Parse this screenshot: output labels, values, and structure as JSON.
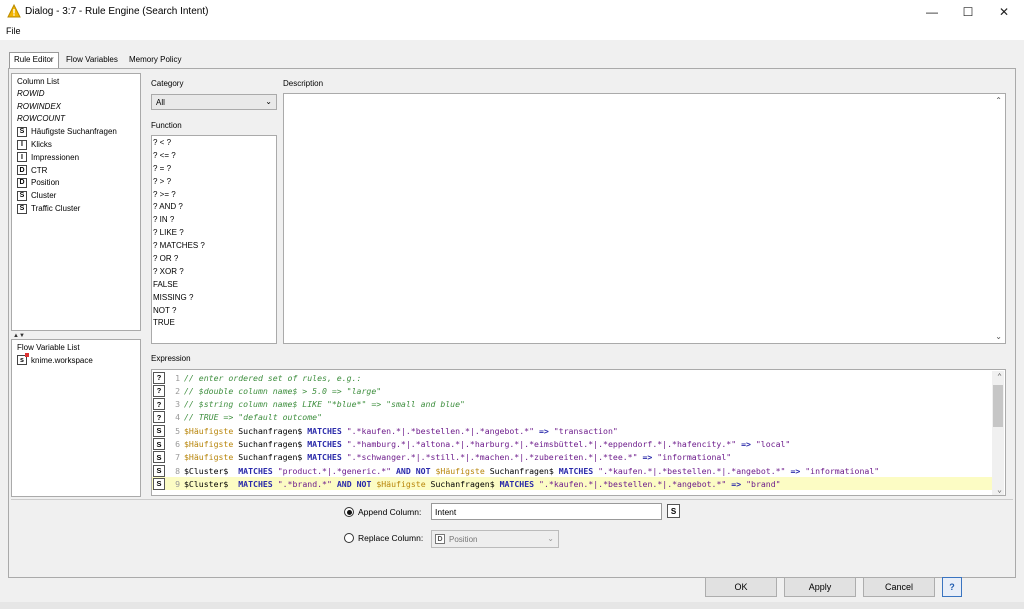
{
  "window": {
    "title": "Dialog - 3:7 - Rule Engine (Search Intent)"
  },
  "menu": {
    "file": "File"
  },
  "tabs": [
    "Rule Editor",
    "Flow Variables",
    "Memory Policy"
  ],
  "column_list": {
    "title": "Column List",
    "items": [
      {
        "type": "",
        "label": "ROWID"
      },
      {
        "type": "",
        "label": "ROWINDEX"
      },
      {
        "type": "",
        "label": "ROWCOUNT"
      },
      {
        "type": "S",
        "label": "Häufigste Suchanfragen"
      },
      {
        "type": "I",
        "label": "Klicks"
      },
      {
        "type": "I",
        "label": "Impressionen"
      },
      {
        "type": "D",
        "label": "CTR"
      },
      {
        "type": "D",
        "label": "Position"
      },
      {
        "type": "S",
        "label": "Cluster"
      },
      {
        "type": "S",
        "label": "Traffic Cluster"
      }
    ]
  },
  "flow_variable_list": {
    "title": "Flow Variable List",
    "items": [
      {
        "type": "s",
        "label": "knime.workspace"
      }
    ]
  },
  "category": {
    "label": "Category",
    "value": "All"
  },
  "function": {
    "label": "Function",
    "items": [
      "? < ?",
      "? <= ?",
      "? = ?",
      "? > ?",
      "? >= ?",
      "? AND ?",
      "? IN ?",
      "? LIKE ?",
      "? MATCHES ?",
      "? OR ?",
      "? XOR ?",
      "FALSE",
      "MISSING ?",
      "NOT ?",
      "TRUE"
    ]
  },
  "description": {
    "label": "Description"
  },
  "expression": {
    "label": "Expression",
    "lines": [
      {
        "gutter": "?",
        "num": "1",
        "text": "// enter ordered set of rules, e.g.:"
      },
      {
        "gutter": "?",
        "num": "2",
        "text": "// $double column name$ > 5.0 => \"large\""
      },
      {
        "gutter": "?",
        "num": "3",
        "text": "// $string column name$ LIKE \"*blue*\" => \"small and blue\""
      },
      {
        "gutter": "?",
        "num": "4",
        "text": "// TRUE => \"default outcome\""
      },
      {
        "gutter": "S",
        "num": "5",
        "text": "$Häufigste Suchanfragen$ MATCHES \".*kaufen.*|.*bestellen.*|.*angebot.*\" => \"transaction\""
      },
      {
        "gutter": "S",
        "num": "6",
        "text": "$Häufigste Suchanfragen$ MATCHES \".*hamburg.*|.*altona.*|.*harburg.*|.*eimsbüttel.*|.*eppendorf.*|.*hafencity.*\" => \"local\""
      },
      {
        "gutter": "S",
        "num": "7",
        "text": "$Häufigste Suchanfragen$ MATCHES \".*schwanger.*|.*still.*|.*machen.*|.*zubereiten.*|.*tee.*\" => \"informational\""
      },
      {
        "gutter": "S",
        "num": "8",
        "text": "$Cluster$  MATCHES \"product.*|.*generic.*\" AND NOT $Häufigste Suchanfragen$ MATCHES \".*kaufen.*|.*bestellen.*|.*angebot.*\" => \"informational\""
      },
      {
        "gutter": "S",
        "num": "9",
        "text": "$Cluster$  MATCHES \".*brand.*\" AND NOT $Häufigste Suchanfragen$ MATCHES \".*kaufen.*|.*bestellen.*|.*angebot.*\" => \"brand\""
      }
    ]
  },
  "output": {
    "append_label": "Append Column:",
    "append_value": "Intent",
    "append_type": "S",
    "replace_label": "Replace Column:",
    "replace_type": "D",
    "replace_value": "Position",
    "mode": "append"
  },
  "buttons": {
    "ok": "OK",
    "apply": "Apply",
    "cancel": "Cancel",
    "help": "?"
  },
  "colors": {
    "comment": "#3f8f3f",
    "keyword": "#2a2aaa",
    "string": "#6e1d8c",
    "column": "#b8860b",
    "highlight": "#fcfcc4",
    "warning_icon": "#f2b400"
  }
}
